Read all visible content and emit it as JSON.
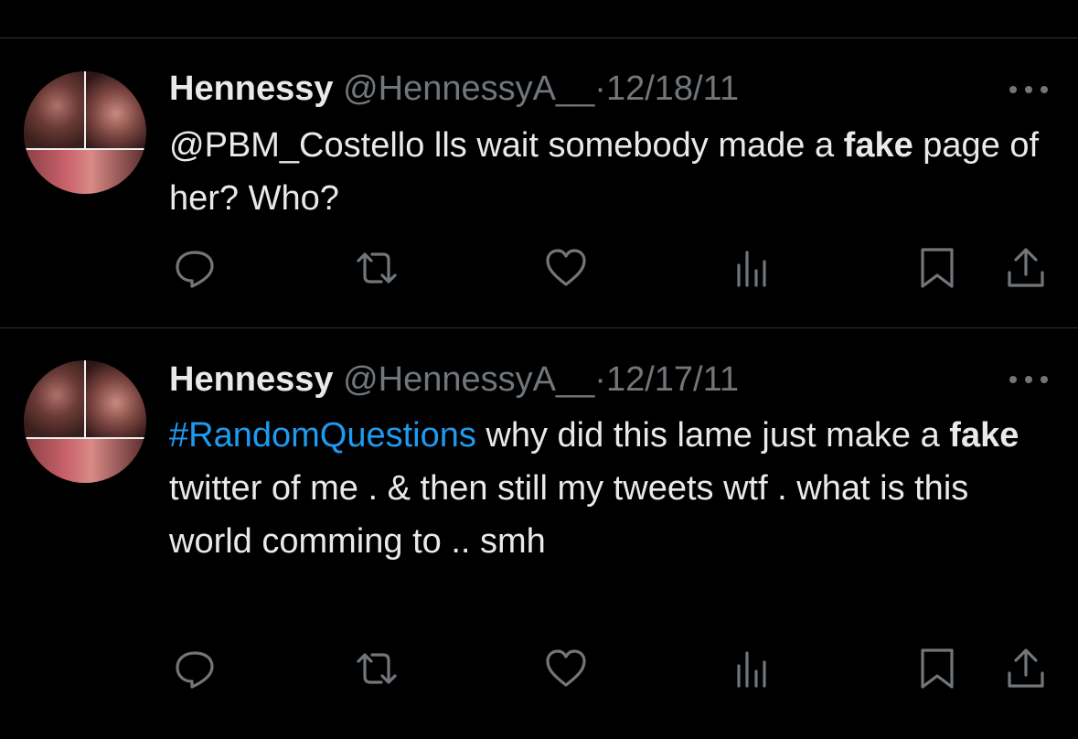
{
  "tweets": [
    {
      "name": "Hennessy",
      "handle": "@HennessyA__",
      "separator": "·",
      "date": "12/18/11",
      "body": {
        "mention": "@PBM_Costello",
        "text1": " lls wait somebody made a ",
        "bold": "fake",
        "text2": " page of her? Who?"
      },
      "actions": [
        "reply-icon",
        "retweet-icon",
        "like-icon",
        "views-icon",
        "bookmark-icon",
        "share-icon"
      ]
    },
    {
      "name": "Hennessy",
      "handle": "@HennessyA__",
      "separator": "·",
      "date": "12/17/11",
      "body": {
        "hashtag": "#RandomQuestions",
        "text1": " why did this lame just make a ",
        "bold": "fake",
        "text2": " twitter of me . & then still my tweets wtf . what is this world comming to .. smh"
      },
      "actions": [
        "reply-icon",
        "retweet-icon",
        "like-icon",
        "views-icon",
        "bookmark-icon",
        "share-icon"
      ]
    }
  ],
  "colors": {
    "background": "#000000",
    "text": "#e7e9ea",
    "muted": "#71767b",
    "link": "#1d9bf0",
    "divider": "#2f3336"
  }
}
